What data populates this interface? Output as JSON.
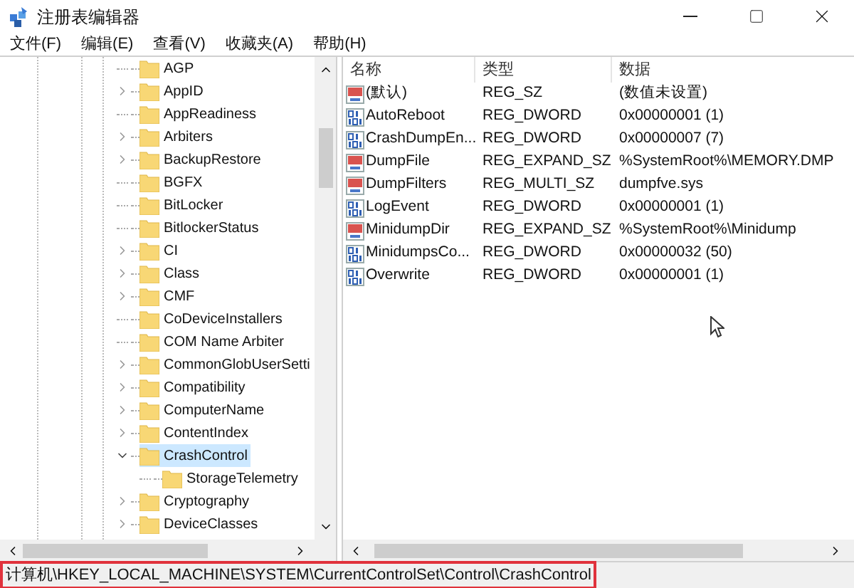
{
  "window": {
    "title": "注册表编辑器"
  },
  "menu": [
    "文件(F)",
    "编辑(E)",
    "查看(V)",
    "收藏夹(A)",
    "帮助(H)"
  ],
  "tree": [
    {
      "kind": "leaf",
      "label": "AGP",
      "selected": false
    },
    {
      "kind": "branch",
      "label": "AppID",
      "expanded": false,
      "selected": false
    },
    {
      "kind": "leaf",
      "label": "AppReadiness",
      "selected": false
    },
    {
      "kind": "branch",
      "label": "Arbiters",
      "expanded": false,
      "selected": false
    },
    {
      "kind": "branch",
      "label": "BackupRestore",
      "expanded": false,
      "selected": false
    },
    {
      "kind": "leaf",
      "label": "BGFX",
      "selected": false
    },
    {
      "kind": "leaf",
      "label": "BitLocker",
      "selected": false
    },
    {
      "kind": "leaf",
      "label": "BitlockerStatus",
      "selected": false
    },
    {
      "kind": "branch",
      "label": "CI",
      "expanded": false,
      "selected": false
    },
    {
      "kind": "branch",
      "label": "Class",
      "expanded": false,
      "selected": false
    },
    {
      "kind": "branch",
      "label": "CMF",
      "expanded": false,
      "selected": false
    },
    {
      "kind": "leaf",
      "label": "CoDeviceInstallers",
      "selected": false
    },
    {
      "kind": "leaf",
      "label": "COM Name Arbiter",
      "selected": false
    },
    {
      "kind": "branch",
      "label": "CommonGlobUserSetti",
      "expanded": false,
      "selected": false
    },
    {
      "kind": "branch",
      "label": "Compatibility",
      "expanded": false,
      "selected": false
    },
    {
      "kind": "branch",
      "label": "ComputerName",
      "expanded": false,
      "selected": false
    },
    {
      "kind": "branch",
      "label": "ContentIndex",
      "expanded": false,
      "selected": false
    },
    {
      "kind": "branch",
      "label": "CrashControl",
      "expanded": true,
      "selected": true,
      "children": [
        {
          "kind": "leaf",
          "label": "StorageTelemetry",
          "selected": false
        }
      ]
    },
    {
      "kind": "branch",
      "label": "Cryptography",
      "expanded": false,
      "selected": false
    },
    {
      "kind": "branch",
      "label": "DeviceClasses",
      "expanded": false,
      "selected": false
    }
  ],
  "values": {
    "columns": [
      "名称",
      "类型",
      "数据"
    ],
    "rows": [
      {
        "kind": "string",
        "name": "(默认)",
        "type": "REG_SZ",
        "data": "(数值未设置)"
      },
      {
        "kind": "binary",
        "name": "AutoReboot",
        "type": "REG_DWORD",
        "data": "0x00000001 (1)"
      },
      {
        "kind": "binary",
        "name": "CrashDumpEn...",
        "type": "REG_DWORD",
        "data": "0x00000007 (7)"
      },
      {
        "kind": "string",
        "name": "DumpFile",
        "type": "REG_EXPAND_SZ",
        "data": "%SystemRoot%\\MEMORY.DMP"
      },
      {
        "kind": "string",
        "name": "DumpFilters",
        "type": "REG_MULTI_SZ",
        "data": "dumpfve.sys"
      },
      {
        "kind": "binary",
        "name": "LogEvent",
        "type": "REG_DWORD",
        "data": "0x00000001 (1)"
      },
      {
        "kind": "string",
        "name": "MinidumpDir",
        "type": "REG_EXPAND_SZ",
        "data": "%SystemRoot%\\Minidump"
      },
      {
        "kind": "binary",
        "name": "MinidumpsCo...",
        "type": "REG_DWORD",
        "data": "0x00000032 (50)"
      },
      {
        "kind": "binary",
        "name": "Overwrite",
        "type": "REG_DWORD",
        "data": "0x00000001 (1)"
      }
    ]
  },
  "status_bar": {
    "path": "计算机\\HKEY_LOCAL_MACHINE\\SYSTEM\\CurrentControlSet\\Control\\CrashControl",
    "highlighted": true
  }
}
